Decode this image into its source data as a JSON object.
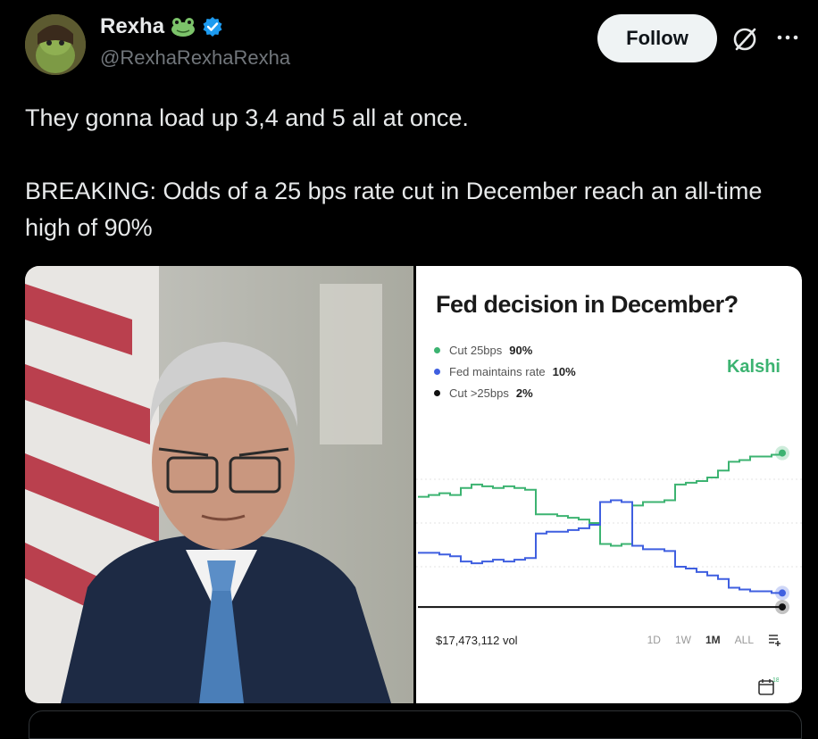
{
  "author": {
    "display_name": "Rexha",
    "handle": "@RexhaRexhaRexha",
    "verified": true
  },
  "actions": {
    "follow_label": "Follow",
    "icons": [
      "grok-icon",
      "more-icon"
    ]
  },
  "tweet": {
    "text": "They gonna load up 3,4 and 5 all at once.\n\nBREAKING: Odds of a 25 bps rate cut in December reach an all-time high of 90%"
  },
  "chart": {
    "title": "Fed decision in December?",
    "brand": "Kalshi",
    "legend": [
      {
        "label": "Cut 25bps",
        "pct": "90%",
        "color": "#3cb371"
      },
      {
        "label": "Fed maintains rate",
        "pct": "10%",
        "color": "#3f5fe0"
      },
      {
        "label": "Cut >25bps",
        "pct": "2%",
        "color": "#111111"
      }
    ],
    "volume": "$17,473,112 vol",
    "ranges": [
      "1D",
      "1W",
      "1M",
      "ALL"
    ],
    "active_range": "1M",
    "calendar_day": "18"
  },
  "chart_data": {
    "type": "line",
    "title": "Fed decision in December?",
    "ylim": [
      0,
      100
    ],
    "series": [
      {
        "name": "Cut 25bps",
        "values": [
          65,
          66,
          67,
          66,
          70,
          72,
          71,
          70,
          71,
          70,
          69,
          55,
          55,
          54,
          53,
          52,
          50,
          38,
          37,
          38,
          60,
          62,
          62,
          63,
          72,
          73,
          74,
          76,
          80,
          85,
          86,
          88,
          88,
          89,
          90
        ]
      },
      {
        "name": "Fed maintains rate",
        "values": [
          33,
          33,
          32,
          31,
          28,
          27,
          28,
          29,
          28,
          29,
          30,
          44,
          45,
          45,
          46,
          47,
          49,
          62,
          63,
          62,
          37,
          35,
          35,
          34,
          25,
          24,
          22,
          20,
          18,
          13,
          12,
          11,
          11,
          10,
          10
        ]
      },
      {
        "name": "Cut >25bps",
        "values": [
          2,
          2,
          2,
          2,
          2,
          2,
          2,
          2,
          2,
          2,
          2,
          2,
          2,
          2,
          2,
          2,
          2,
          2,
          2,
          2,
          2,
          2,
          2,
          2,
          2,
          2,
          2,
          2,
          2,
          2,
          2,
          2,
          2,
          2,
          2
        ]
      }
    ]
  }
}
